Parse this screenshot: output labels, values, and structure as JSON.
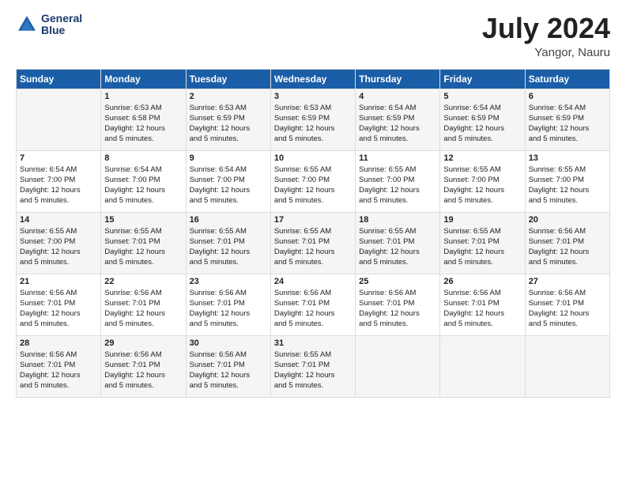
{
  "header": {
    "logo_line1": "General",
    "logo_line2": "Blue",
    "month": "July 2024",
    "location": "Yangor, Nauru"
  },
  "weekdays": [
    "Sunday",
    "Monday",
    "Tuesday",
    "Wednesday",
    "Thursday",
    "Friday",
    "Saturday"
  ],
  "weeks": [
    [
      {
        "day": "",
        "info": ""
      },
      {
        "day": "1",
        "info": "Sunrise: 6:53 AM\nSunset: 6:58 PM\nDaylight: 12 hours\nand 5 minutes."
      },
      {
        "day": "2",
        "info": "Sunrise: 6:53 AM\nSunset: 6:59 PM\nDaylight: 12 hours\nand 5 minutes."
      },
      {
        "day": "3",
        "info": "Sunrise: 6:53 AM\nSunset: 6:59 PM\nDaylight: 12 hours\nand 5 minutes."
      },
      {
        "day": "4",
        "info": "Sunrise: 6:54 AM\nSunset: 6:59 PM\nDaylight: 12 hours\nand 5 minutes."
      },
      {
        "day": "5",
        "info": "Sunrise: 6:54 AM\nSunset: 6:59 PM\nDaylight: 12 hours\nand 5 minutes."
      },
      {
        "day": "6",
        "info": "Sunrise: 6:54 AM\nSunset: 6:59 PM\nDaylight: 12 hours\nand 5 minutes."
      }
    ],
    [
      {
        "day": "7",
        "info": "Sunrise: 6:54 AM\nSunset: 7:00 PM\nDaylight: 12 hours\nand 5 minutes."
      },
      {
        "day": "8",
        "info": "Sunrise: 6:54 AM\nSunset: 7:00 PM\nDaylight: 12 hours\nand 5 minutes."
      },
      {
        "day": "9",
        "info": "Sunrise: 6:54 AM\nSunset: 7:00 PM\nDaylight: 12 hours\nand 5 minutes."
      },
      {
        "day": "10",
        "info": "Sunrise: 6:55 AM\nSunset: 7:00 PM\nDaylight: 12 hours\nand 5 minutes."
      },
      {
        "day": "11",
        "info": "Sunrise: 6:55 AM\nSunset: 7:00 PM\nDaylight: 12 hours\nand 5 minutes."
      },
      {
        "day": "12",
        "info": "Sunrise: 6:55 AM\nSunset: 7:00 PM\nDaylight: 12 hours\nand 5 minutes."
      },
      {
        "day": "13",
        "info": "Sunrise: 6:55 AM\nSunset: 7:00 PM\nDaylight: 12 hours\nand 5 minutes."
      }
    ],
    [
      {
        "day": "14",
        "info": "Sunrise: 6:55 AM\nSunset: 7:00 PM\nDaylight: 12 hours\nand 5 minutes."
      },
      {
        "day": "15",
        "info": "Sunrise: 6:55 AM\nSunset: 7:01 PM\nDaylight: 12 hours\nand 5 minutes."
      },
      {
        "day": "16",
        "info": "Sunrise: 6:55 AM\nSunset: 7:01 PM\nDaylight: 12 hours\nand 5 minutes."
      },
      {
        "day": "17",
        "info": "Sunrise: 6:55 AM\nSunset: 7:01 PM\nDaylight: 12 hours\nand 5 minutes."
      },
      {
        "day": "18",
        "info": "Sunrise: 6:55 AM\nSunset: 7:01 PM\nDaylight: 12 hours\nand 5 minutes."
      },
      {
        "day": "19",
        "info": "Sunrise: 6:55 AM\nSunset: 7:01 PM\nDaylight: 12 hours\nand 5 minutes."
      },
      {
        "day": "20",
        "info": "Sunrise: 6:56 AM\nSunset: 7:01 PM\nDaylight: 12 hours\nand 5 minutes."
      }
    ],
    [
      {
        "day": "21",
        "info": "Sunrise: 6:56 AM\nSunset: 7:01 PM\nDaylight: 12 hours\nand 5 minutes."
      },
      {
        "day": "22",
        "info": "Sunrise: 6:56 AM\nSunset: 7:01 PM\nDaylight: 12 hours\nand 5 minutes."
      },
      {
        "day": "23",
        "info": "Sunrise: 6:56 AM\nSunset: 7:01 PM\nDaylight: 12 hours\nand 5 minutes."
      },
      {
        "day": "24",
        "info": "Sunrise: 6:56 AM\nSunset: 7:01 PM\nDaylight: 12 hours\nand 5 minutes."
      },
      {
        "day": "25",
        "info": "Sunrise: 6:56 AM\nSunset: 7:01 PM\nDaylight: 12 hours\nand 5 minutes."
      },
      {
        "day": "26",
        "info": "Sunrise: 6:56 AM\nSunset: 7:01 PM\nDaylight: 12 hours\nand 5 minutes."
      },
      {
        "day": "27",
        "info": "Sunrise: 6:56 AM\nSunset: 7:01 PM\nDaylight: 12 hours\nand 5 minutes."
      }
    ],
    [
      {
        "day": "28",
        "info": "Sunrise: 6:56 AM\nSunset: 7:01 PM\nDaylight: 12 hours\nand 5 minutes."
      },
      {
        "day": "29",
        "info": "Sunrise: 6:56 AM\nSunset: 7:01 PM\nDaylight: 12 hours\nand 5 minutes."
      },
      {
        "day": "30",
        "info": "Sunrise: 6:56 AM\nSunset: 7:01 PM\nDaylight: 12 hours\nand 5 minutes."
      },
      {
        "day": "31",
        "info": "Sunrise: 6:55 AM\nSunset: 7:01 PM\nDaylight: 12 hours\nand 5 minutes."
      },
      {
        "day": "",
        "info": ""
      },
      {
        "day": "",
        "info": ""
      },
      {
        "day": "",
        "info": ""
      }
    ]
  ]
}
